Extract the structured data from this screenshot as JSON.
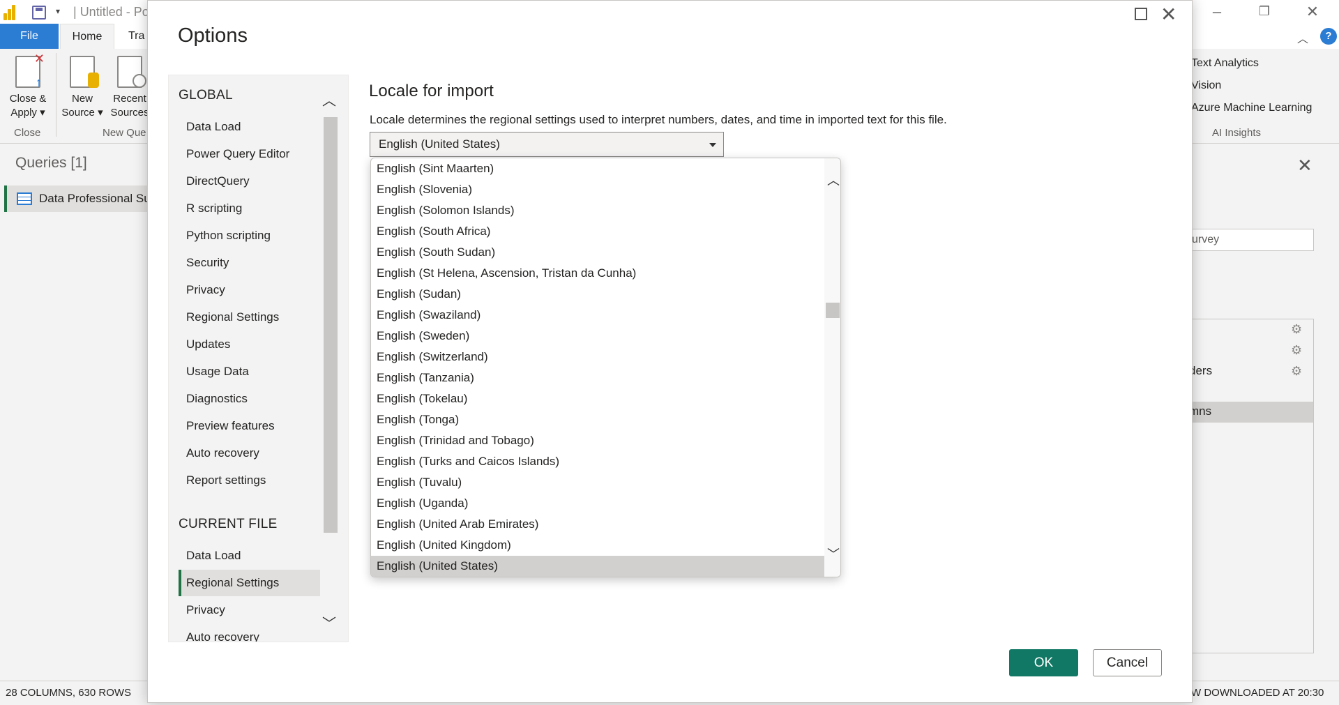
{
  "app": {
    "title": "Untitled - Po",
    "tabs": {
      "file": "File",
      "home": "Home",
      "transform": "Tra"
    },
    "ribbon": {
      "close_apply": [
        "Close &",
        "Apply"
      ],
      "new_source": [
        "New",
        "Source"
      ],
      "recent_sources": [
        "Recent",
        "Sources"
      ],
      "group_close": "Close",
      "group_new_query": "New Que",
      "ai": [
        "Text Analytics",
        "Vision",
        "Azure Machine Learning"
      ],
      "group_ai": "AI Insights"
    },
    "queries": {
      "title": "Queries [1]",
      "item": "Data Professional Su"
    },
    "right_pane": {
      "name_value": "urvey",
      "steps": [
        "ders",
        "mns"
      ]
    },
    "status": {
      "left": "28 COLUMNS, 630 ROWS",
      "right": "W DOWNLOADED AT 20:30"
    }
  },
  "dialog": {
    "title": "Options",
    "nav": {
      "global_header": "GLOBAL",
      "global_items": [
        "Data Load",
        "Power Query Editor",
        "DirectQuery",
        "R scripting",
        "Python scripting",
        "Security",
        "Privacy",
        "Regional Settings",
        "Updates",
        "Usage Data",
        "Diagnostics",
        "Preview features",
        "Auto recovery",
        "Report settings"
      ],
      "current_header": "CURRENT FILE",
      "current_items": [
        "Data Load",
        "Regional Settings",
        "Privacy",
        "Auto recovery"
      ],
      "active_item": "Regional Settings"
    },
    "content": {
      "heading": "Locale for import",
      "description": "Locale determines the regional settings used to interpret numbers, dates, and time in imported text for this file.",
      "selected_locale": "English (United States)"
    },
    "dropdown_options": [
      "English (Sint Maarten)",
      "English (Slovenia)",
      "English (Solomon Islands)",
      "English (South Africa)",
      "English (South Sudan)",
      "English (St Helena, Ascension, Tristan da Cunha)",
      "English (Sudan)",
      "English (Swaziland)",
      "English (Sweden)",
      "English (Switzerland)",
      "English (Tanzania)",
      "English (Tokelau)",
      "English (Tonga)",
      "English (Trinidad and Tobago)",
      "English (Turks and Caicos Islands)",
      "English (Tuvalu)",
      "English (Uganda)",
      "English (United Arab Emirates)",
      "English (United Kingdom)",
      "English (United States)"
    ],
    "buttons": {
      "ok": "OK",
      "cancel": "Cancel"
    }
  },
  "colors": {
    "accent": "#117865",
    "file_tab": "#2b7cd3",
    "selection_bar": "#217346"
  }
}
